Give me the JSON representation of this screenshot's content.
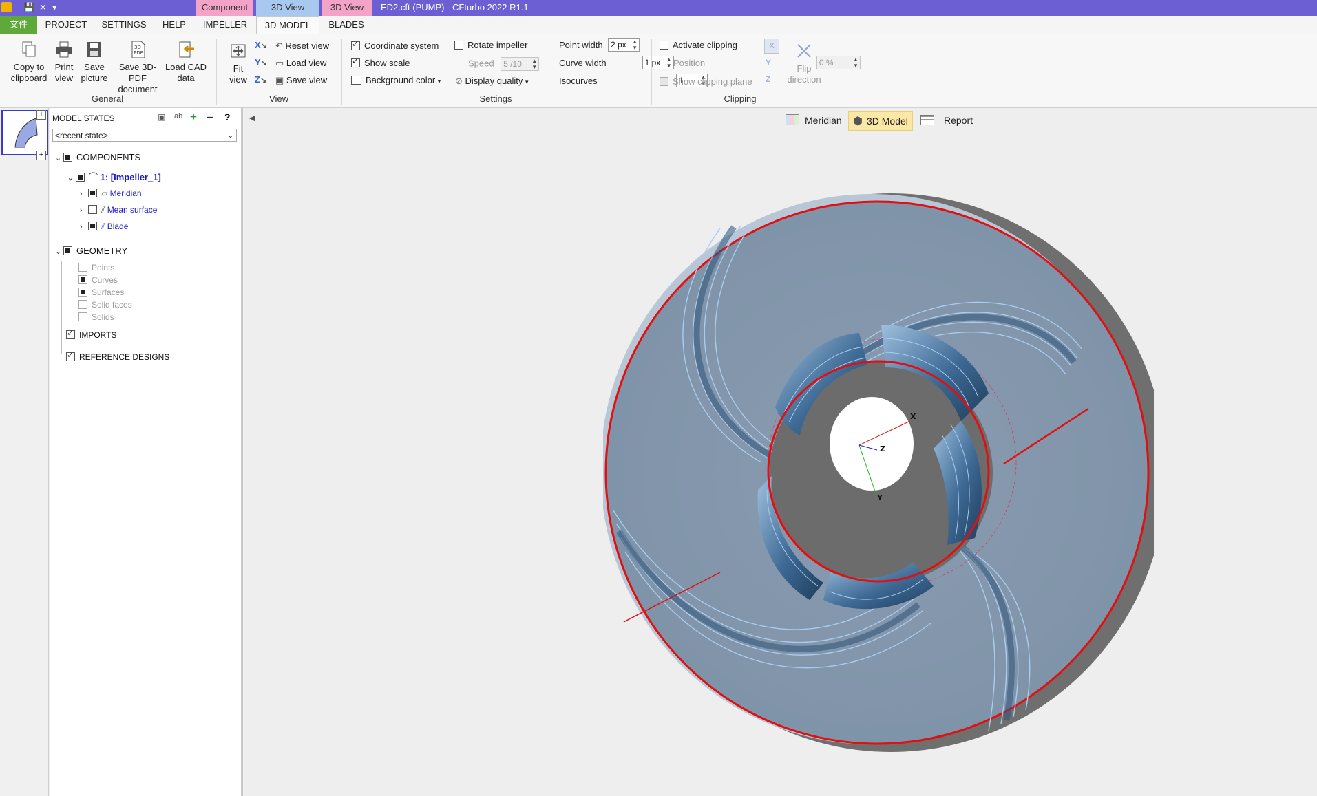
{
  "titlebar": {
    "app_icon": "cfturbo-logo",
    "qat_save": "save-icon",
    "qat_close": "x-icon",
    "qat_more": "dropdown-icon",
    "context_tabs": [
      {
        "label": "Component",
        "color": "#f4a3c8"
      },
      {
        "label": "3D View",
        "color": "#a9c8ef"
      },
      {
        "label": "3D View",
        "color": "#f4a3c8"
      }
    ],
    "title": "ED2.cft (PUMP) - CFturbo 2022 R1.1",
    "bar_color": "#6b5fd3"
  },
  "menu_tabs": [
    {
      "label": "文件"
    },
    {
      "label": "PROJECT"
    },
    {
      "label": "SETTINGS"
    },
    {
      "label": "HELP"
    },
    {
      "label": "IMPELLER"
    },
    {
      "label": "3D MODEL"
    },
    {
      "label": "BLADES"
    }
  ],
  "ribbon": {
    "general": {
      "label": "General",
      "buttons": [
        {
          "label1": "Copy to",
          "label2": "clipboard",
          "icon": "copy-icon"
        },
        {
          "label1": "Print",
          "label2": "view",
          "icon": "print-icon"
        },
        {
          "label1": "Save",
          "label2": "picture",
          "icon": "save-picture-icon"
        },
        {
          "label1": "Save 3D-PDF",
          "label2": "document",
          "icon": "pdf-3d-icon"
        },
        {
          "label1": "Load CAD",
          "label2": "data",
          "icon": "load-cad-icon"
        }
      ]
    },
    "view": {
      "label": "View",
      "fit_label1": "Fit",
      "fit_label2": "view",
      "reset": "Reset view",
      "load": "Load view",
      "save": "Save view"
    },
    "settings": {
      "label": "Settings",
      "coordinate_system": "Coordinate system",
      "show_scale": "Show scale",
      "background_color": "Background color",
      "rotate_impeller": "Rotate impeller",
      "speed_label": "Speed",
      "speed_value": "5 /10",
      "display_quality": "Display quality",
      "point_width_label": "Point width",
      "point_width_value": "2 px",
      "curve_width_label": "Curve width",
      "curve_width_value": "1 px",
      "isocurves_label": "Isocurves",
      "isocurves_value": "1"
    },
    "clipping": {
      "label": "Clipping",
      "activate": "Activate clipping",
      "position_label": "Position",
      "position_value": "0 %",
      "show_plane": "Show clipping plane",
      "flip_label1": "Flip",
      "flip_label2": "direction"
    }
  },
  "model_states": {
    "header": "MODEL STATES",
    "dropdown_value": "<recent state>",
    "tool_icons": [
      "save-icon",
      "rename-icon",
      "add-icon",
      "remove-icon",
      "help-icon"
    ]
  },
  "tree": {
    "components": "COMPONENTS",
    "impeller": "1: [Impeller_1]",
    "meridian": "Meridian",
    "mean_surface": "Mean surface",
    "blade": "Blade",
    "geometry": "GEOMETRY",
    "points": "Points",
    "curves": "Curves",
    "surfaces": "Surfaces",
    "solid_faces": "Solid faces",
    "solids": "Solids",
    "imports": "IMPORTS",
    "reference_designs": "REFERENCE DESIGNS"
  },
  "viewport": {
    "tabs": [
      {
        "label": "Meridian",
        "icon": "meridian-icon"
      },
      {
        "label": "3D Model",
        "icon": "cube-icon"
      },
      {
        "label": "Report",
        "icon": "table-icon"
      }
    ],
    "axis_labels": {
      "x": "X",
      "y": "Y",
      "z": "Z"
    },
    "background": "#eeeeee",
    "impeller_color": "#7f93a8",
    "outline_color": "#e01010"
  }
}
